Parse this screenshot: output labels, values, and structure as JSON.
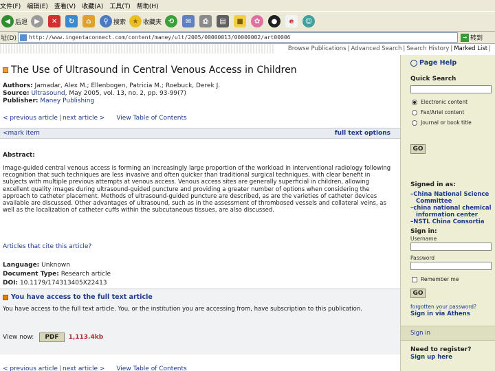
{
  "browser": {
    "menu": [
      "文件(F)",
      "编辑(E)",
      "查看(V)",
      "收藏(A)",
      "工具(T)",
      "帮助(H)"
    ],
    "toolbar": {
      "back_label": "后退",
      "search_label": "搜索",
      "favorites_label": "收藏夹"
    },
    "address": {
      "label": "址(D)",
      "url": "http://www.ingentaconnect.com/content/maney/ult/2005/00000013/00000002/art00006",
      "go_label": "转到"
    }
  },
  "topnav": [
    "Browse Publications",
    "Advanced Search",
    "Search History",
    "Marked List"
  ],
  "article": {
    "title": "The Use of Ultrasound in Central Venous Access in Children",
    "authors_label": "Authors:",
    "authors": "Jamadar, Alex M.; Ellenbogen, Patricia M.; Roebuck, Derek J.",
    "source_label": "Source:",
    "source_journal": "Ultrasound",
    "source_rest": ", May 2005, vol. 13, no. 2, pp. 93-99(7)",
    "publisher_label": "Publisher:",
    "publisher": "Maney Publishing",
    "prev_article": "< previous article",
    "next_article": "next article >",
    "toc": "View Table of Contents",
    "mark_item": "<mark item",
    "full_text_options": "full text options",
    "abstract_head": "Abstract:",
    "abstract_text": "Image-guided central venous access is forming an increasingly large proportion of the workload in interventional radiology following recognition that such techniques are less invasive and often quicker than traditional surgical techniques, with clear benefit in subjects with multiple previous attempts at venous access. Venous access sites are generally superficial in children, allowing excellent quality images during ultrasound-guided puncture and providing a greater number of options when considering the approach to catheter placement. Methods of ultrasound-guided puncture are described, as are the varieties of catheter devices available are discussed. Other advantages of ultrasound, such as in the assessment of thrombosed vessels and collateral veins, as well as the localization of catheter cuffs within the subcutaneous tissues, are also discussed.",
    "articles_cite": "Articles that cite this article?",
    "language_label": "Language:",
    "language": "Unknown",
    "doctype_label": "Document Type:",
    "doctype": "Research article",
    "doi_label": "DOI:",
    "doi": "10.1179/174313405X22413"
  },
  "access": {
    "title": "You have access to the full text article",
    "text": "You have access to the full text article. You, or the institution you are accessing from, have subscription to this publication.",
    "view_now": "View now:",
    "pdf": "PDF",
    "size": "1,113.4kb"
  },
  "sidebar": {
    "page_help": "Page Help",
    "quick_search": "Quick Search",
    "radio_options": [
      "Electronic content",
      "Fax/Ariel content",
      "Journal or book title"
    ],
    "radio_selected": 0,
    "go": "GO",
    "signed_in_as": "Signed in as:",
    "signed_items": [
      {
        "text": "–China National Science",
        "indent": false
      },
      {
        "text": "Committee",
        "indent": true
      },
      {
        "text": "–china national chemical",
        "indent": false
      },
      {
        "text": "information center",
        "indent": true
      },
      {
        "text": "–NSTL China Consortia",
        "indent": false
      }
    ],
    "sign_in": "Sign in:",
    "username_label": "Username",
    "password_label": "Password",
    "remember_me": "Remember me",
    "forgotten_password": "forgotten your password?",
    "sign_in_athens": "Sign in via Athens",
    "sign_in_box": "Sign in",
    "need_register": "Need to register?",
    "sign_up": "Sign up here"
  },
  "colors": {
    "link": "#1a3a8a",
    "sidebar_bg": "#eeeed4",
    "size_red": "#b03030"
  }
}
